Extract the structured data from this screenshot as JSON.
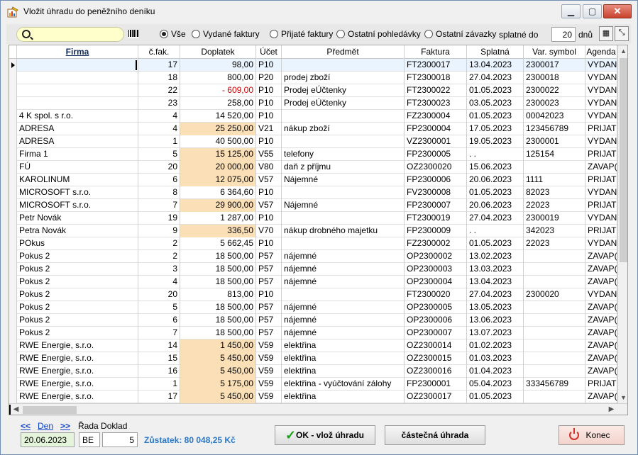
{
  "window": {
    "title": "Vložit úhradu do peněžního deníku"
  },
  "toolbar": {
    "search_value": "",
    "filters": [
      "Vše",
      "Vydané faktury",
      "Přijaté faktury",
      "Ostatní pohledávky",
      "Ostatní závazky"
    ],
    "selected_filter": "Vše",
    "due_label": "splatné do",
    "due_value": "20",
    "due_unit": "dnů"
  },
  "grid": {
    "columns": [
      "Firma",
      "č.fak.",
      "Doplatek",
      "Účet",
      "Předmět",
      "Faktura",
      "Splatná",
      "Var. symbol",
      "Agenda"
    ],
    "sorted_column": "Firma",
    "rows": [
      [
        "",
        "17",
        "98,00",
        "P10",
        "",
        "FT2300017",
        "13.04.2023",
        "2300017",
        "VYDAN"
      ],
      [
        "",
        "18",
        "800,00",
        "P20",
        "prodej zboží",
        "FT2300018",
        "27.04.2023",
        "2300018",
        "VYDAN"
      ],
      [
        "",
        "22",
        "- 609,00",
        "P10",
        "Prodej eÚčtenky",
        "FT2300022",
        "01.05.2023",
        "2300022",
        "VYDAN"
      ],
      [
        "",
        "23",
        "258,00",
        "P10",
        "Prodej eÚčtenky",
        "FT2300023",
        "03.05.2023",
        "2300023",
        "VYDAN"
      ],
      [
        "4 K spol. s r.o.",
        "4",
        "14 520,00",
        "P10",
        "",
        "FZ2300004",
        "01.05.2023",
        "00042023",
        "VYDAN"
      ],
      [
        "ADRESA",
        "4",
        "25 250,00",
        "V21",
        "nákup zboží",
        "FP2300004",
        "17.05.2023",
        "123456789",
        "PRIJAT"
      ],
      [
        "ADRESA",
        "1",
        "40 500,00",
        "P10",
        "",
        "VZ2300001",
        "19.05.2023",
        "2300001",
        "VYDAN"
      ],
      [
        "Firma 1",
        "5",
        "15 125,00",
        "V55",
        "telefony",
        "FP2300005",
        ".  .",
        "125154",
        "PRIJAT"
      ],
      [
        "FÚ",
        "20",
        "20 000,00",
        "V80",
        "daň z příjmu",
        "OZ2300020",
        "15.06.2023",
        "",
        "ZAVAP("
      ],
      [
        "KAROLINUM",
        "6",
        "12 075,00",
        "V57",
        "Nájemné",
        "FP2300006",
        "20.06.2023",
        "1111",
        "PRIJAT"
      ],
      [
        "MICROSOFT s.r.o.",
        "8",
        "6 364,60",
        "P10",
        "",
        "FV2300008",
        "01.05.2023",
        "82023",
        "VYDAN"
      ],
      [
        "MICROSOFT s.r.o.",
        "7",
        "29 900,00",
        "V57",
        "Nájemné",
        "FP2300007",
        "20.06.2023",
        "22023",
        "PRIJAT"
      ],
      [
        "Petr Novák",
        "19",
        "1 287,00",
        "P10",
        "",
        "FT2300019",
        "27.04.2023",
        "2300019",
        "VYDAN"
      ],
      [
        "Petra Novák",
        "9",
        "336,50",
        "V70",
        "nákup drobného majetku",
        "FP2300009",
        ".  .",
        "342023",
        "PRIJAT"
      ],
      [
        "POkus",
        "2",
        "5 662,45",
        "P10",
        "",
        "FZ2300002",
        "01.05.2023",
        "22023",
        "VYDAN"
      ],
      [
        "Pokus 2",
        "2",
        "18 500,00",
        "P57",
        "nájemné",
        "OP2300002",
        "13.02.2023",
        "",
        "ZAVAP("
      ],
      [
        "Pokus 2",
        "3",
        "18 500,00",
        "P57",
        "nájemné",
        "OP2300003",
        "13.03.2023",
        "",
        "ZAVAP("
      ],
      [
        "Pokus 2",
        "4",
        "18 500,00",
        "P57",
        "nájemné",
        "OP2300004",
        "13.04.2023",
        "",
        "ZAVAP("
      ],
      [
        "Pokus 2",
        "20",
        "813,00",
        "P10",
        "",
        "FT2300020",
        "27.04.2023",
        "2300020",
        "VYDAN"
      ],
      [
        "Pokus 2",
        "5",
        "18 500,00",
        "P57",
        "nájemné",
        "OP2300005",
        "13.05.2023",
        "",
        "ZAVAP("
      ],
      [
        "Pokus 2",
        "6",
        "18 500,00",
        "P57",
        "nájemné",
        "OP2300006",
        "13.06.2023",
        "",
        "ZAVAP("
      ],
      [
        "Pokus 2",
        "7",
        "18 500,00",
        "P57",
        "nájemné",
        "OP2300007",
        "13.07.2023",
        "",
        "ZAVAP("
      ],
      [
        "RWE Energie, s.r.o.",
        "14",
        "1 450,00",
        "V59",
        "elektřina",
        "OZ2300014",
        "01.02.2023",
        "",
        "ZAVAP("
      ],
      [
        "RWE Energie, s.r.o.",
        "15",
        "5 450,00",
        "V59",
        "elektřina",
        "OZ2300015",
        "01.03.2023",
        "",
        "ZAVAP("
      ],
      [
        "RWE Energie, s.r.o.",
        "16",
        "5 450,00",
        "V59",
        "elektřina",
        "OZ2300016",
        "01.04.2023",
        "",
        "ZAVAP("
      ],
      [
        "RWE Energie, s.r.o.",
        "1",
        "5 175,00",
        "V59",
        "elektřina - vyúčtování zálohy",
        "FP2300001",
        "05.04.2023",
        "333456789",
        "PRIJAT"
      ],
      [
        "RWE Energie, s.r.o.",
        "17",
        "5 450,00",
        "V59",
        "elektřina",
        "OZ2300017",
        "01.05.2023",
        "",
        "ZAVAP("
      ]
    ]
  },
  "footer": {
    "prev_label": "<<",
    "day_label": "Den",
    "next_label": ">>",
    "series_label": "Řada Doklad",
    "date_value": "20.06.2023",
    "series_value": "BE",
    "doc_value": "5",
    "balance_text": "Zůstatek: 80 048,25 Kč",
    "ok_label": "OK - vlož úhradu",
    "partial_label": "částečná úhrada",
    "end_label": "Konec"
  }
}
